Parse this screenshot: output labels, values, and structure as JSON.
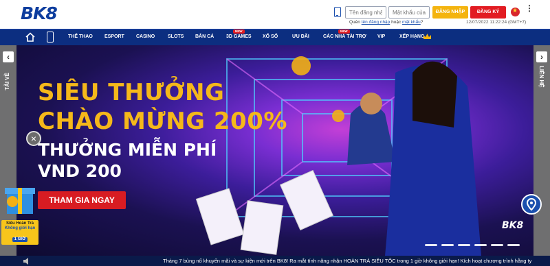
{
  "header": {
    "logo_text": "BK8",
    "username_placeholder": "Tên đăng nhập",
    "password_placeholder": "Mật khẩu của bạn",
    "login_label": "ĐĂNG NHẬP",
    "register_label": "ĐĂNG KÝ",
    "forgot_prefix": "Quên",
    "forgot_username": "tên đăng nhập",
    "forgot_middle": "hoặc",
    "forgot_password": "mật khẩu",
    "forgot_suffix": "?",
    "datetime": "12/07/2022 11:22:24 (GMT+7)",
    "menu_dots": "⋮",
    "icons": [
      "phone-icon",
      "vietnam-flag-icon",
      "kebab-menu-icon"
    ]
  },
  "nav": {
    "items": [
      {
        "label": "THỂ THAO"
      },
      {
        "label": "ESPORT"
      },
      {
        "label": "CASINO"
      },
      {
        "label": "SLOTS"
      },
      {
        "label": "BẮN CÁ"
      },
      {
        "label": "3D GAMES",
        "badge": "NEW"
      },
      {
        "label": "XỔ SỐ"
      },
      {
        "label": "ƯU ĐÃI"
      },
      {
        "label": "CÁC NHÀ TÀI TRỢ",
        "badge": "NEW"
      },
      {
        "label": "VIP"
      },
      {
        "label": "XẾP HẠNG"
      }
    ],
    "icons": [
      "home-icon",
      "mobile-icon",
      "crown-icon"
    ]
  },
  "hero": {
    "headline_line1": "SIÊU THƯỞNG",
    "headline_line2": "CHÀO MỪNG 200%",
    "sub_line1": "THƯỞNG MIỄN PHÍ",
    "sub_line2": "VND 200",
    "cta_label": "THAM GIA NGAY",
    "watermark": "BK8",
    "slide_count": 6,
    "active_slide": 6
  },
  "side_tabs": {
    "left_label": "TẢI VỀ",
    "left_arrow": "‹",
    "right_label": "LIÊN HỆ",
    "right_arrow": "›"
  },
  "promo_widget": {
    "line1": "Siêu Hoàn Trả",
    "line2": "Không giới hạn",
    "hour": "1 GIỜ",
    "close": "×"
  },
  "marquee": {
    "text": "Tháng 7 bùng nổ khuyến mãi và sự kiện mới trên BK8! Ra mắt tính năng nhận HOÀN TRẢ SIÊU TỐC trong 1 giờ không giới hạn! Kích hoạt chương trình hằng ty"
  },
  "colors": {
    "brand_blue": "#0c2e80",
    "login_yellow": "#f4b40f",
    "register_red": "#e21c22",
    "headline_gold": "#f5b81a"
  }
}
